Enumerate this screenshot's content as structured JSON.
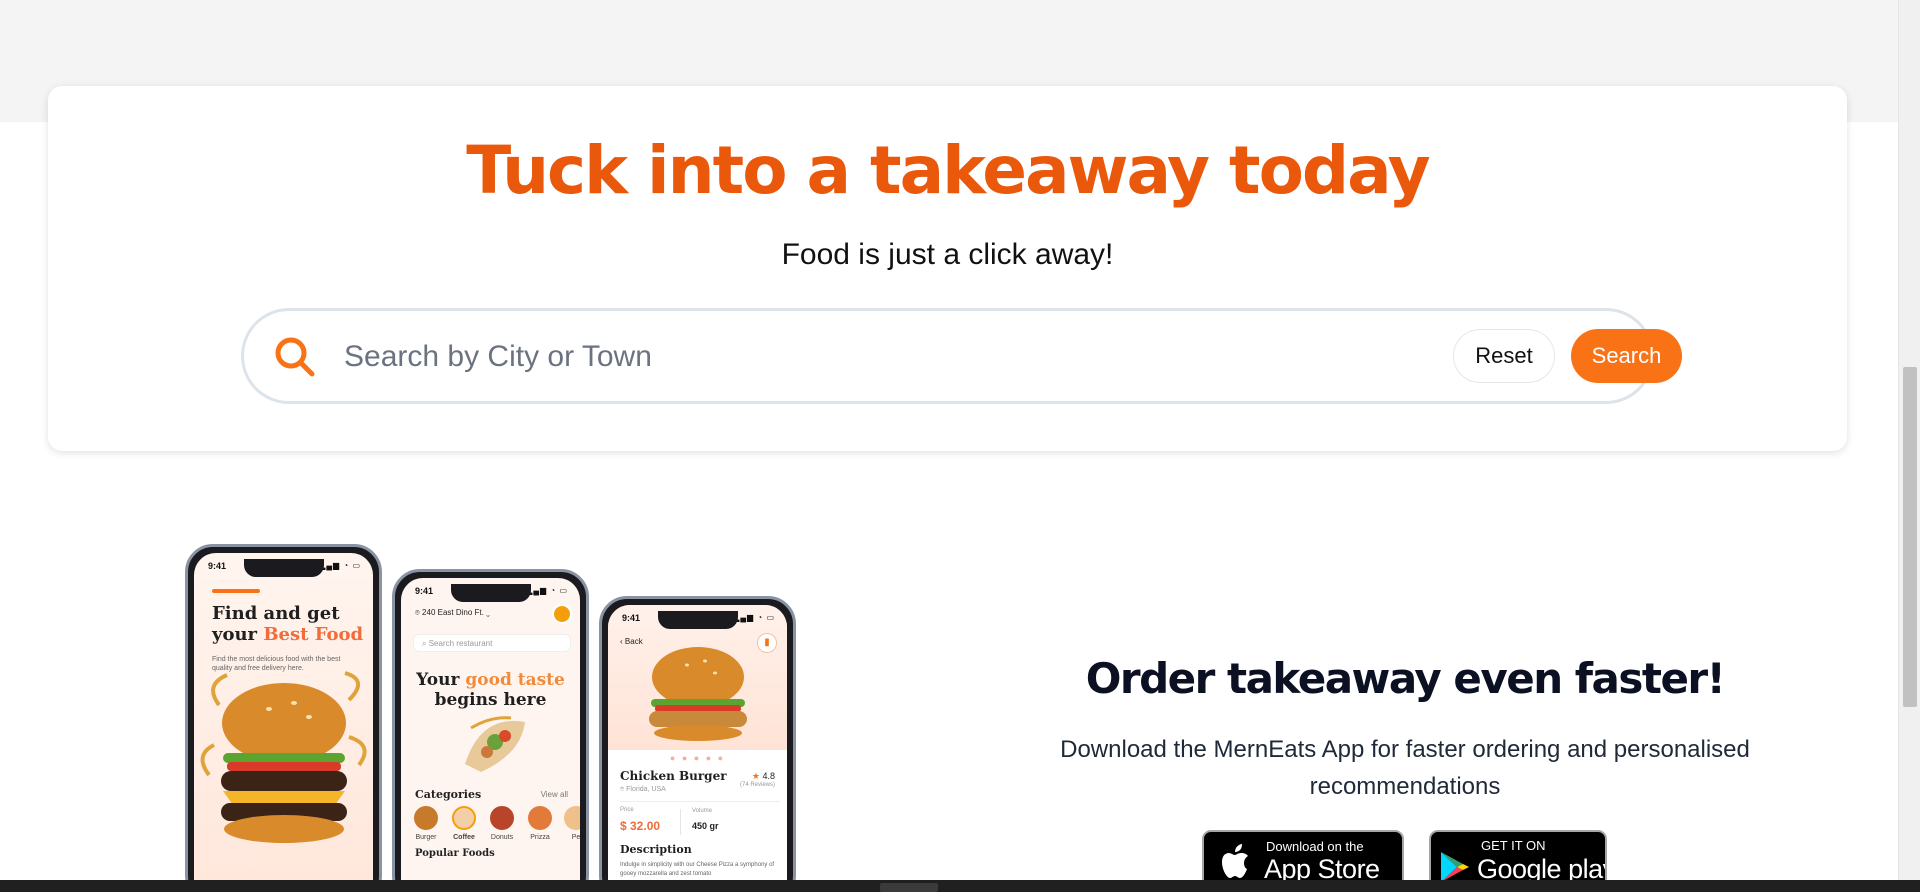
{
  "hero": {
    "title": "Tuck into a takeaway today",
    "subtitle": "Food is just a click away!",
    "search_placeholder": "Search by City or Town",
    "search_value": "",
    "reset_label": "Reset",
    "search_label": "Search"
  },
  "phones": {
    "status_time": "9:41",
    "phone1": {
      "title_line1": "Find and get",
      "title_line2_prefix": "your ",
      "title_accent": "Best Food",
      "description": "Find the most delicious food with the best quality and free delivery here."
    },
    "phone2": {
      "location": "240 East Dino Ft.",
      "search_placeholder": "Search restaurant",
      "head_prefix": "Your ",
      "head_accent": "good taste",
      "head_line2": "begins here",
      "categories_label": "Categories",
      "view_all": "View all",
      "categories": [
        "Burger",
        "Coffee",
        "Donuts",
        "Prizza",
        "Pe"
      ],
      "popular_label": "Popular Foods"
    },
    "phone3": {
      "back_label": "Back",
      "product_name": "Chicken Burger",
      "location": "Florida, USA",
      "rating": "4.8",
      "reviews": "(74 Reviews)",
      "price_label": "Price",
      "price": "$ 32.00",
      "volume_label": "Volume",
      "volume": "450 gr",
      "description_heading": "Description",
      "description": "Indulge in simplicity with our Cheese Pizza a symphony of gooey mozzarella and zest tomato"
    }
  },
  "promo": {
    "title": "Order takeaway even faster!",
    "text": "Download the MernEats App for faster ordering and personalised recommendations",
    "appstore_small": "Download on the",
    "appstore_big": "App Store",
    "gplay_small": "GET IT ON",
    "gplay_big": "Google play"
  },
  "colors": {
    "accent": "#ea580c",
    "button": "#f97316",
    "background_band": "#f4f4f4"
  }
}
